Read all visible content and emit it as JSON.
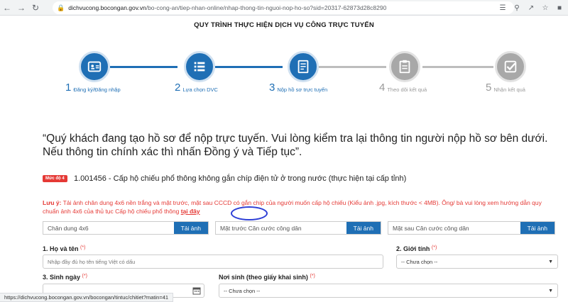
{
  "browser": {
    "url_host": "dichvucong.bocongan.gov.vn",
    "url_path": "/bo-cong-an/tiep-nhan-online/nhap-thong-tin-nguoi-nop-ho-so?sid=20317-62873d28c8290",
    "status_url": "https://dichvucong.bocongan.gov.vn/bocongan/tintuc/chitiet?matin=41"
  },
  "page": {
    "process_title": "QUY TRÌNH THỰC HIỆN DỊCH VỤ CÔNG TRỰC TUYẾN",
    "steps": [
      {
        "num": "1",
        "label": "Đăng ký/Đăng nhập",
        "state": "active"
      },
      {
        "num": "2",
        "label": "Lựa chọn DVC",
        "state": "active"
      },
      {
        "num": "3",
        "label": "Nộp hồ sơ trực tuyến",
        "state": "active"
      },
      {
        "num": "4",
        "label": "Theo dõi kết quả",
        "state": "inactive"
      },
      {
        "num": "5",
        "label": "Nhận kết quả",
        "state": "inactive"
      }
    ],
    "notice": "“Quý khách đang tạo hồ sơ để nộp trực tuyến. Vui lòng kiểm tra lại thông tin người nộp hồ sơ bên dưới. Nếu thông tin chính xác thì nhấn Đồng ý và Tiếp tục”.",
    "level_badge": "Mức độ 4",
    "service_name": "1.001456 - Cấp hộ chiếu phổ thông không gắn chíp điện tử ở trong nước (thực hiện tại cấp tỉnh)",
    "note_prefix": "Lưu ý:",
    "note_text": " Tải ảnh chân dung 4x6 nền trắng và mặt trước, mặt sau CCCD có gắn chip của người muốn cấp hộ chiếu (Kiểu ảnh .jpg, kích thước < 4MB). Ông/ bà vui lòng xem hướng dẫn quy chuẩn ảnh 4x6 của thủ tục Cấp hộ chiếu phổ thông ",
    "note_link": "tại đây",
    "uploads": [
      {
        "placeholder": "Chân dung 4x6",
        "button": "Tải ảnh"
      },
      {
        "placeholder": "Mặt trước Căn cước công dân",
        "button": "Tải ảnh"
      },
      {
        "placeholder": "Mặt sau Căn cước công dân",
        "button": "Tải ảnh"
      }
    ],
    "fields": {
      "name_label": "1. Họ và tên",
      "name_placeholder": "Nhập đầy đủ họ tên tiếng Việt có dấu",
      "gender_label": "2. Giới tính",
      "gender_value": "-- Chưa chọn --",
      "dob_label": "3. Sinh ngày",
      "pob_label": "Nơi sinh (theo giấy khai sinh)",
      "pob_value": "-- Chưa chọn --",
      "required_mark": "(*)"
    }
  }
}
